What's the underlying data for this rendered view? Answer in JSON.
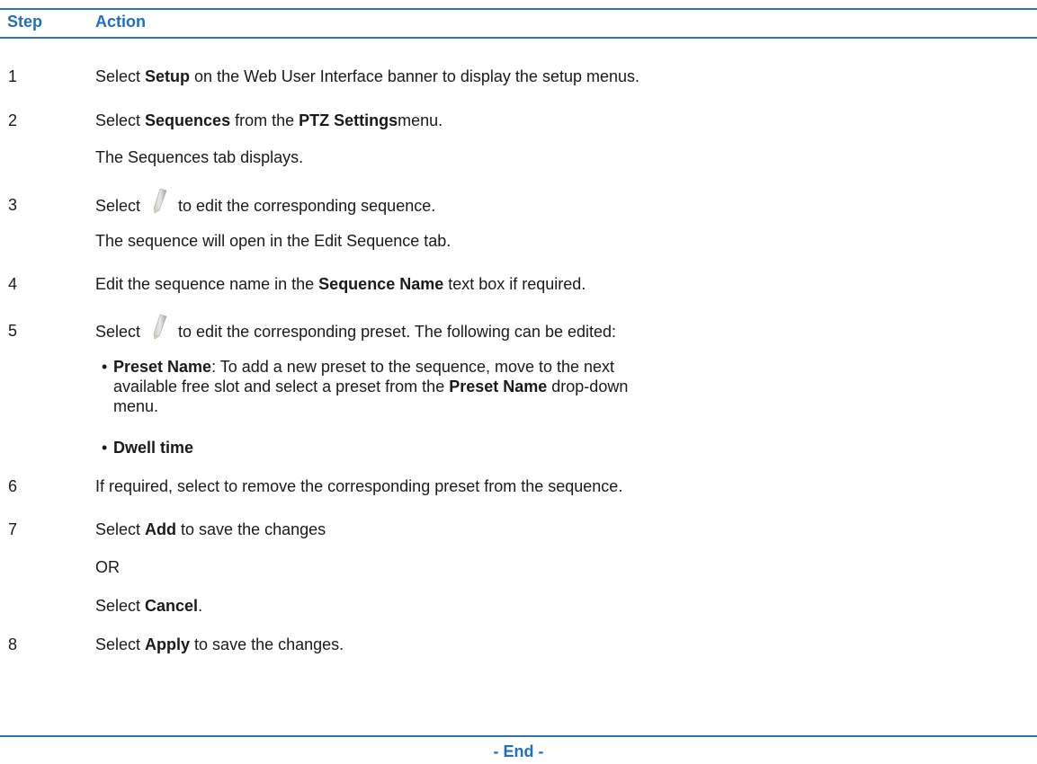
{
  "table": {
    "header": {
      "step": "Step",
      "action": "Action"
    },
    "rows": [
      {
        "step": "1",
        "lines": [
          {
            "pre": "Select ",
            "b1": "Setup",
            "post": " on the Web User Interface banner to display the setup menus."
          }
        ]
      },
      {
        "step": "2",
        "lines": [
          {
            "pre": "Select ",
            "b1": "Sequences",
            "mid": " from the ",
            "b2": "PTZ Settings",
            "post": "menu."
          },
          {
            "text": "The Sequences tab displays."
          }
        ]
      },
      {
        "step": "3",
        "lines": [
          {
            "pre": "Select",
            "icon": "pencil-edit-icon",
            "post": "to edit the corresponding sequence."
          },
          {
            "text": "The sequence will open in the Edit Sequence tab."
          }
        ]
      },
      {
        "step": "4",
        "lines": [
          {
            "pre": "Edit the sequence name in the ",
            "b1": "Sequence Name",
            "post": " text box if required."
          }
        ]
      },
      {
        "step": "5",
        "lines": [
          {
            "pre": "Select",
            "icon": "pencil-edit-icon",
            "post": "to edit the corresponding preset. The following can be edited:"
          }
        ],
        "bullets": [
          {
            "b": "Preset Name",
            "text1": ": To add a new preset to the sequence, move to the next available free slot and select a preset from the ",
            "b2": "Preset Name",
            "text2": " drop-down menu."
          },
          {
            "b": "Dwell time"
          }
        ]
      },
      {
        "step": "6",
        "lines": [
          {
            "text": "If required, select to remove the corresponding preset from the sequence."
          }
        ]
      },
      {
        "step": "7",
        "lines": [
          {
            "pre": "Select ",
            "b1": "Add",
            "post": " to save the changes"
          },
          {
            "text": "OR"
          },
          {
            "pre": "Select ",
            "b1": "Cancel",
            "post": "."
          }
        ]
      },
      {
        "step": "8",
        "lines": [
          {
            "pre": "Select ",
            "b1": "Apply",
            "post": " to save the changes."
          }
        ]
      }
    ]
  },
  "footer": {
    "end": "- End -"
  },
  "colors": {
    "accent": "#1f6fbf",
    "rule": "#2e74b5"
  }
}
